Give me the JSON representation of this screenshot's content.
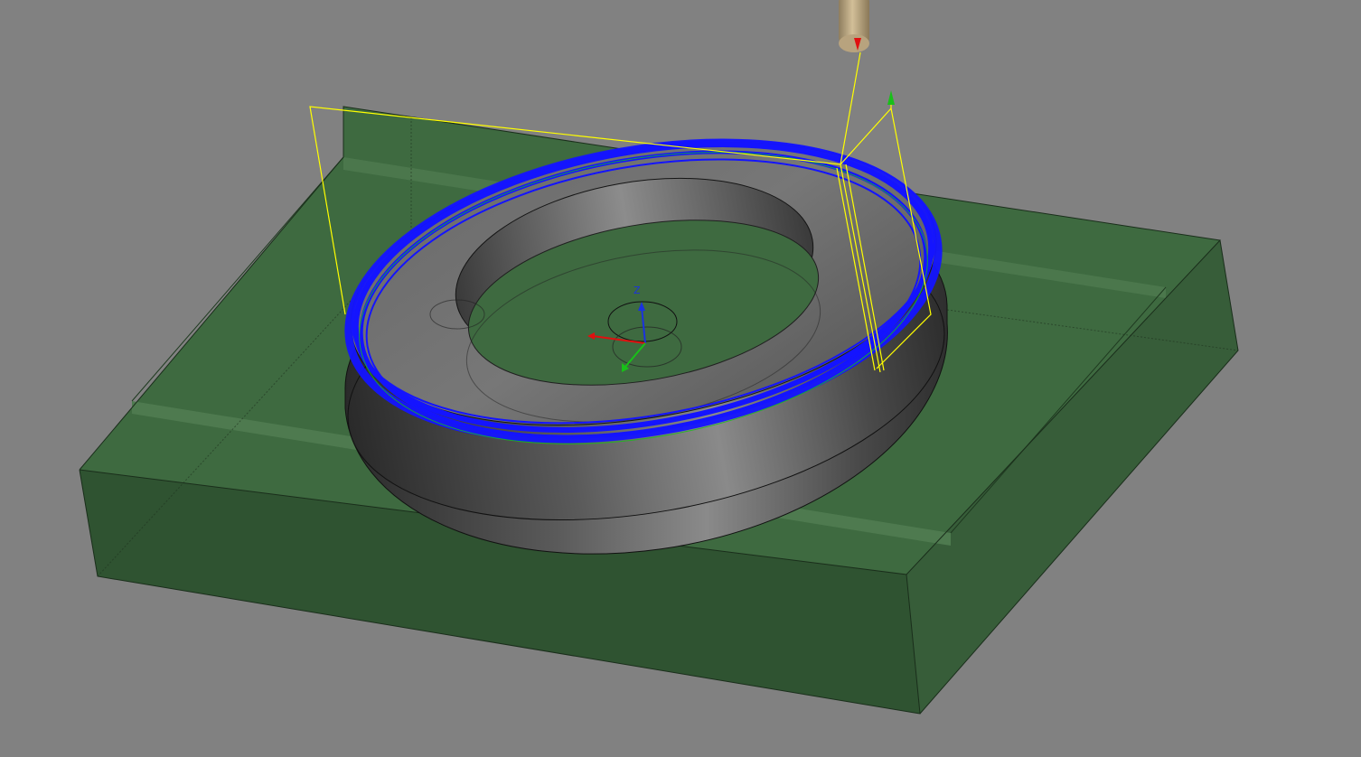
{
  "viewport": {
    "background": "#818181",
    "axis_labels": {
      "z": "Z"
    }
  },
  "colors": {
    "stock": "#3e6a40",
    "stock_dark": "#2f5331",
    "part": "#4f4f4f",
    "toolpath": "#1414ff",
    "tool_holder": "#b8a37e",
    "link_moves": "#ffff00",
    "axis_x": "#e01010",
    "axis_y": "#18c018",
    "axis_z": "#1a32e0"
  },
  "icons": [
    "tool-icon",
    "coordinate-triad-icon",
    "toolpath-direction-arrow-icon"
  ]
}
